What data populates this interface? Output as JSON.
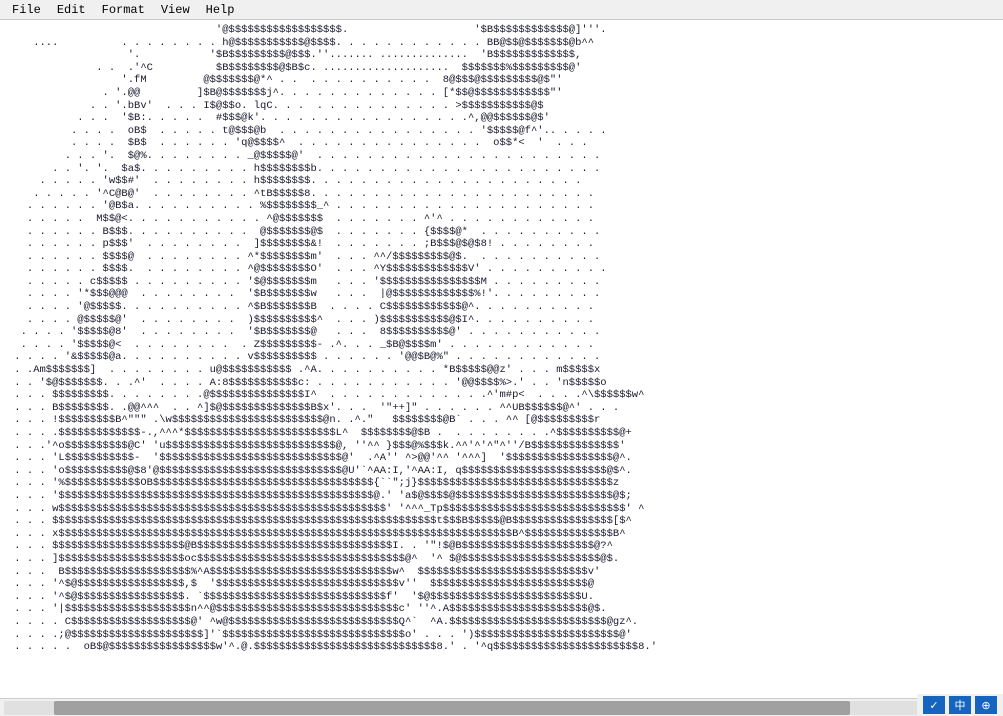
{
  "menubar": {
    "items": [
      "File",
      "Edit",
      "Format",
      "View",
      "Help"
    ]
  },
  "ascii_art": "                                 '@$$$$$$$$$$$$$$$$$$.                    '$B$$$$$$$$$$$$@]'''.\n    ....          . . . . . . . . h@$$$$$$$$$$$@$$$$. . . . . . . . . . . . BB@$$@$$$$$$$@b^^\n                   '.           '$B$$$$$$$$$@$$$.''....... ..............  'B$$$$$$$$$$$$$,\n              . .  .'^C          $B$$$$$$$$@$B$c. ....................  $$$$$$$%$$$$$$$$$@'\n                  '.fM         @$$$$$$$@*^ . .  . . . . . . . . . .  8@$$$@$$$$$$$$$@$\"'\n               . '.@@         ]$B@$$$$$$$j^. . . . . . . . . . . . . [*$$@$$$$$$$$$$$$\"'\n             . . '.bBv'  . . . I$@$$o. lqC. . .  . . . . . . . . . . . >$$$$$$$$$$$@$\n           . . .  '$B:. . . . .  #$$$@k'. . . . . . . . . . . . . . . . .^,@@$$$$$$@$'\n          . . . .  oB$  . . . . . t@$$$@b  . . . . . . . . . . . . . . . . '$$$$$@f^'.. . . . .\n          . . . .  $B$  . . . . . . 'q@$$$$^  . . . . . . . . . . . . . . .  o$$*<  '  . . .\n         . . . '.  $@%. . . . . . . . _@$$$$$@'  . . . . . . . . . . . . . . . . . . . . . . .\n       . . '. '.  $a$. . . . . . . . . h$$$$$$$$b. . . . . . . . . . . . . . . . . . . . . . .\n     . . . . . 'w$$#'  . . . . . . . . h$$$$$$$$. . . . . . . . . . . . . . . . . . . . . .\n    . . . . . '^C@B@'  . . . . . . . . ^tB$$$$$8. . . . . . . . . . . . . . . . . . . . . . .\n   . . . . . . '@B$a. . . . . . . . . . %$$$$$$$$_^ . . . . . . . . . . . . . . . . . . . . .\n   . . . . .  M$$@<. . . . . . . . . . . ^@$$$$$$$  . . . . . . . ^'^ . . . . . . . . . . . .\n   . . . . . . B$$$. . . . . . . . . .  @$$$$$$$@$  . . . . . . . {$$$$@*  . . . . . . . . . .\n   . . . . . . p$$$'  . . . . . . . .  ]$$$$$$$$&!  . . . . . . . ;B$$$@$@$8! . . . . . . . .\n   . . . . . . $$$$@  . . . . . . . . ^*$$$$$$$$m'  . . . ^^/$$$$$$$$$@$.  . . . . . . . . . .\n   . . . . . . $$$$.  . . . . . . . . ^@$$$$$$$$O'  . . . ^Y$$$$$$$$$$$$$V' . . . . . . . . . .\n   . . . . . c$$$$$ . . . . . . . . . '$@$$$$$$$m   . . . '$$$$$$$$$$$$$$$$M . . . . . . . . .\n   . . . . '*$$$@@@  . . . . . . . .  '$B$$$$$$$w   . . .  |@$$$$$$$$$$$$$%!'. . . . . . . . .\n   . . . . '@$$$$$. . . . . . . . . . ^$B$$$$$$$B  . . . . C$$$$$$$$$$$$@^. . . . . . . . . .\n   . . . . @$$$$$@'  . . . . . . . .  )$$$$$$$$$$^  . . . )$$$$$$$$$$$@$I^. . . . . . . . . .\n  . . . . '$$$$$@8'  . . . . . . . .  '$B$$$$$$$@   . . .  8$$$$$$$$$$@' . . . . . . . . . . .\n  . . . . '$$$$$@<  . . . . . . . .  . Z$$$$$$$$$- .^. . . _$B@$$$$m' . . . . . . . . . . . .\n . . . . '&$$$$$@a. . . . . . . . . . v$$$$$$$$$$ . . . . . . '@@$B@%\" . . . . . . . . . . . .\n . .Am$$$$$$$]  . . . . . . . . u@$$$$$$$$$$$ .^A. . . . . . . . . . *B$$$$$@@z' . . . m$$$$$x\n . . '$@$$$$$$$. . .^'  . . . . A:8$$$$$$$$$$$c: . . . . . . . . . . . '@@$$$$%>.' . . 'n$$$$$o\n . . . $$$$$$$$$. . . . . . . .@$$$$$$$$$$$$$$$I^  . . . . . . . . . . . . .^'m#p<  . . . .^\\$$$$$$w^\n . . . B$$$$$$$$. .@@^^^  . . ^]$@$$$$$$$$$$$$$$B$x'. . .  '\"++]\" . . . . . . ^^UB$$$$$$@^' . . .\n . . . !$$$$$$$$$B^\"\"\" .\\w$$$$$$$$$$$$$$$$$$$$$$$$@n. .^.\"   $$$$$$$$@B` . . . ^^ [@$$$$$$$$$r\n . . . .$$$$$$$$$$$$$-.,^^^*$$$$$$$$$$$$$$$$$$$$$$$$L^  $$$$$$$$@$B .  . . . . . . . .^$$$$$$$$$$@+\n . . .'^o$$$$$$$$$$@C' 'u$$$$$$$$$$$$$$$$$$$$$$$$$$$@, ''^^ }$$$@%$$$k.^^'^'^\"^''/B$$$$$$$$$$$$$$'\n . . . 'L$$$$$$$$$$$-  '$$$$$$$$$$$$$$$$$$$$$$$$$$$$$@'  .^A'' ^>@@'^^ '^^^]  '$$$$$$$$$$$$$$$$$@^.\n . . . 'o$$$$$$$$$$@$8'@$$$$$$$$$$$$$$$$$$$$$$$$$$$$$@U'`^AA:I,'^AA:I, q$$$$$$$$$$$$$$$$$$$$$$$@$^.\n . . . '%$$$$$$$$$$$$OB$$$$$$$$$$$$$$$$$$$$$$$$$$$$$$$$$$${``\";j}$$$$$$$$$$$$$$$$$$$$$$$$$$$$$$$z\n . . . '$$$$$$$$$$$$$$$$$$$$$$$$$$$$$$$$$$$$$$$$$$$$$$$$$$@.' 'a$@$$$$@$$$$$$$$$$$$$$$$$$$$$$$$$@$;\n . . . w$$$$$$$$$$$$$$$$$$$$$$$$$$$$$$$$$$$$$$$$$$$$$$$$$$$$' '^^^_Tp$$$$$$$$$$$$$$$$$$$$$$$$$$$$$' ^\n . . . $$$$$$$$$$$$$$$$$$$$$$$$$$$$$$$$$$$$$$$$$$$$$$$$$$$$$$$$$$$$$t$$$B$$$$$@B$$$$$$$$$$$$$$$$[$^\n . . . x$$$$$$$$$$$$$$$$$$$$$$$$$$$$$$$$$$$$$$$$$$$$$$$$$$$$$$$$$$$$$$$$$$$$$$$$B^$$$$$$$$$$$$$$B^\n . . . $$$$$$$$$$$$$$$$$$$$$@B$$$$$$$$$$$$$$$$$$$$$$$$$$$$$$$I. . '\"!$@B$$$$$$$$$$$$$$$$$$$$$@?^\n . . . ]$$$$$$$$$$$$$$$$$$$$oc$$$$$$$$$$$$$$$$$$$$$$$$$$$$$$$$$@^  '^ $@$$$$$$$$$$$$$$$$$$$$$$@$.\n . . .  B$$$$$$$$$$$$$$$$$$$$%^A$$$$$$$$$$$$$$$$$$$$$$$$$$$$$w^  $$$$$$$$$$$$$$$$$$$$$$$$$$$v'\n . . . '^$@$$$$$$$$$$$$$$$$$,$  '$$$$$$$$$$$$$$$$$$$$$$$$$$$$$v''  $$$$$$$$$$$$$$$$$$$$$$$$$@\n . . . '^$@$$$$$$$$$$$$$$$$$. `$$$$$$$$$$$$$$$$$$$$$$$$$$$$$f'  '$@$$$$$$$$$$$$$$$$$$$$$$$$U.\n . . . '|$$$$$$$$$$$$$$$$$$$$n^^@$$$$$$$$$$$$$$$$$$$$$$$$$$$$$c' ''^.A$$$$$$$$$$$$$$$$$$$$$$@$.\n . . . . C$$$$$$$$$$$$$$$$$$$@' ^w@$$$$$$$$$$$$$$$$$$$$$$$$$$$Q^`  ^A.$$$$$$$$$$$$$$$$$$$$$$$$$@gz^.\n . . . .;@$$$$$$$$$$$$$$$$$$$$$]'`$$$$$$$$$$$$$$$$$$$$$$$$$$$$$o' . . . ')$$$$$$$$$$$$$$$$$$$$$$$@'\n . . . . .  oB$@$$$$$$$$$$$$$$$$$w'^.@.$$$$$$$$$$$$$$$$$$$$$$$$$$$$$8.' . '^q$$$$$$$$$$$$$$$$$$$$$$$8.'",
  "statusbar": {
    "check_label": "✓",
    "zh_label": "中",
    "extra": "⊕"
  },
  "scrollbar": {
    "horizontal": true
  }
}
